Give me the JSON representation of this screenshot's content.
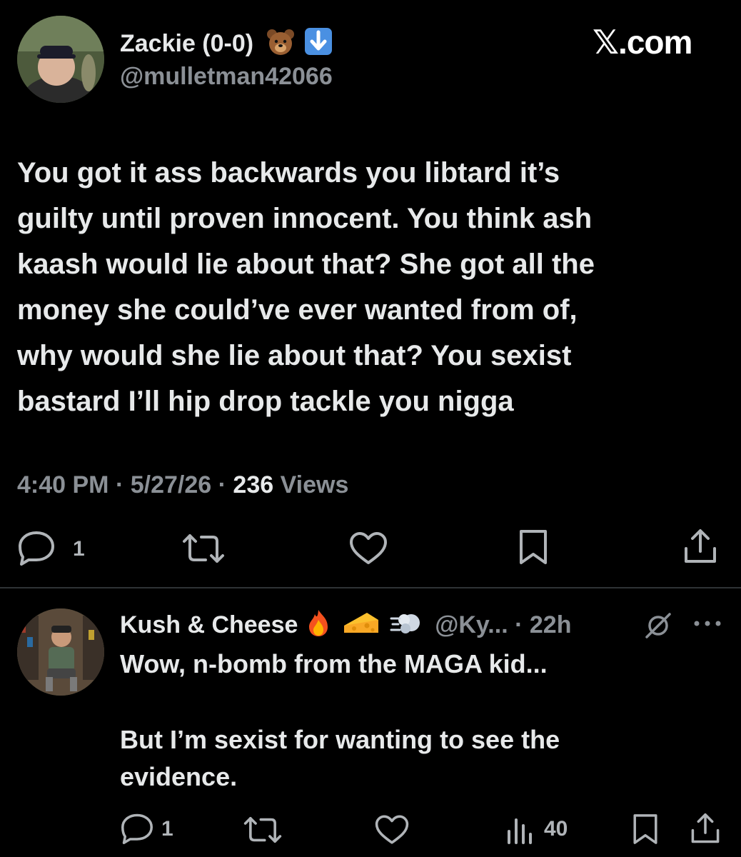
{
  "brand": "𝕏.com",
  "tweet": {
    "display_name": "Zackie (0-0)",
    "name_emojis": [
      "🐻",
      "⬇️"
    ],
    "handle": "@mulletman42066",
    "lines": [
      "You got it ass backwards you libtard it’s",
      "guilty until proven innocent. You think ash",
      "kaash would lie about that? She got all the",
      "money she could’ve ever wanted from of,",
      "why would she lie about that? You sexist",
      "bastard I’ll hip drop tackle you nigga"
    ],
    "time": "4:40 PM",
    "sep1": "·",
    "date": "5/27/26",
    "sep2": "·",
    "views_count": "236",
    "views_label": "Views",
    "reply_count": "1"
  },
  "reply": {
    "display_name": "Kush & Cheese",
    "name_emojis": [
      "🔥",
      "🧀",
      "💨"
    ],
    "handle": "@Ky...",
    "sep": "·",
    "age": "22h",
    "line1": "Wow, n-bomb from the MAGA kid...",
    "line2": "But I’m sexist for wanting to see the",
    "line3": "evidence.",
    "reply_count": "1",
    "views_count": "40"
  },
  "colors": {
    "background": "#000000",
    "text": "#e7e9ea",
    "muted": "#8b9096",
    "divider": "#2f3336",
    "badge_blue": "#4a90e2"
  }
}
